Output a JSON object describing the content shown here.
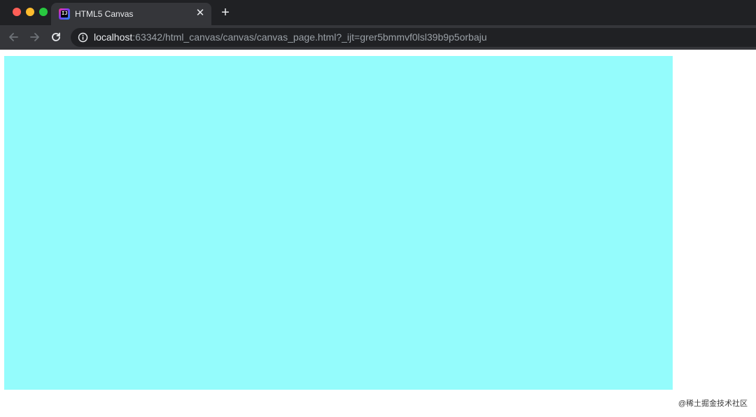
{
  "tab": {
    "title": "HTML5 Canvas",
    "favicon_text": "IJ",
    "close_glyph": "✕"
  },
  "new_tab_glyph": "+",
  "toolbar": {
    "url_host": "localhost",
    "url_rest": ":63342/html_canvas/canvas/canvas_page.html?_ijt=grer5bmmvf0lsl39b9p5orbaju"
  },
  "page": {
    "canvas_color": "#94fcfc"
  },
  "watermark": "@稀土掘金技术社区",
  "icons": [
    "back-arrow-icon",
    "forward-arrow-icon",
    "reload-icon",
    "info-icon",
    "close-icon",
    "plus-icon"
  ]
}
